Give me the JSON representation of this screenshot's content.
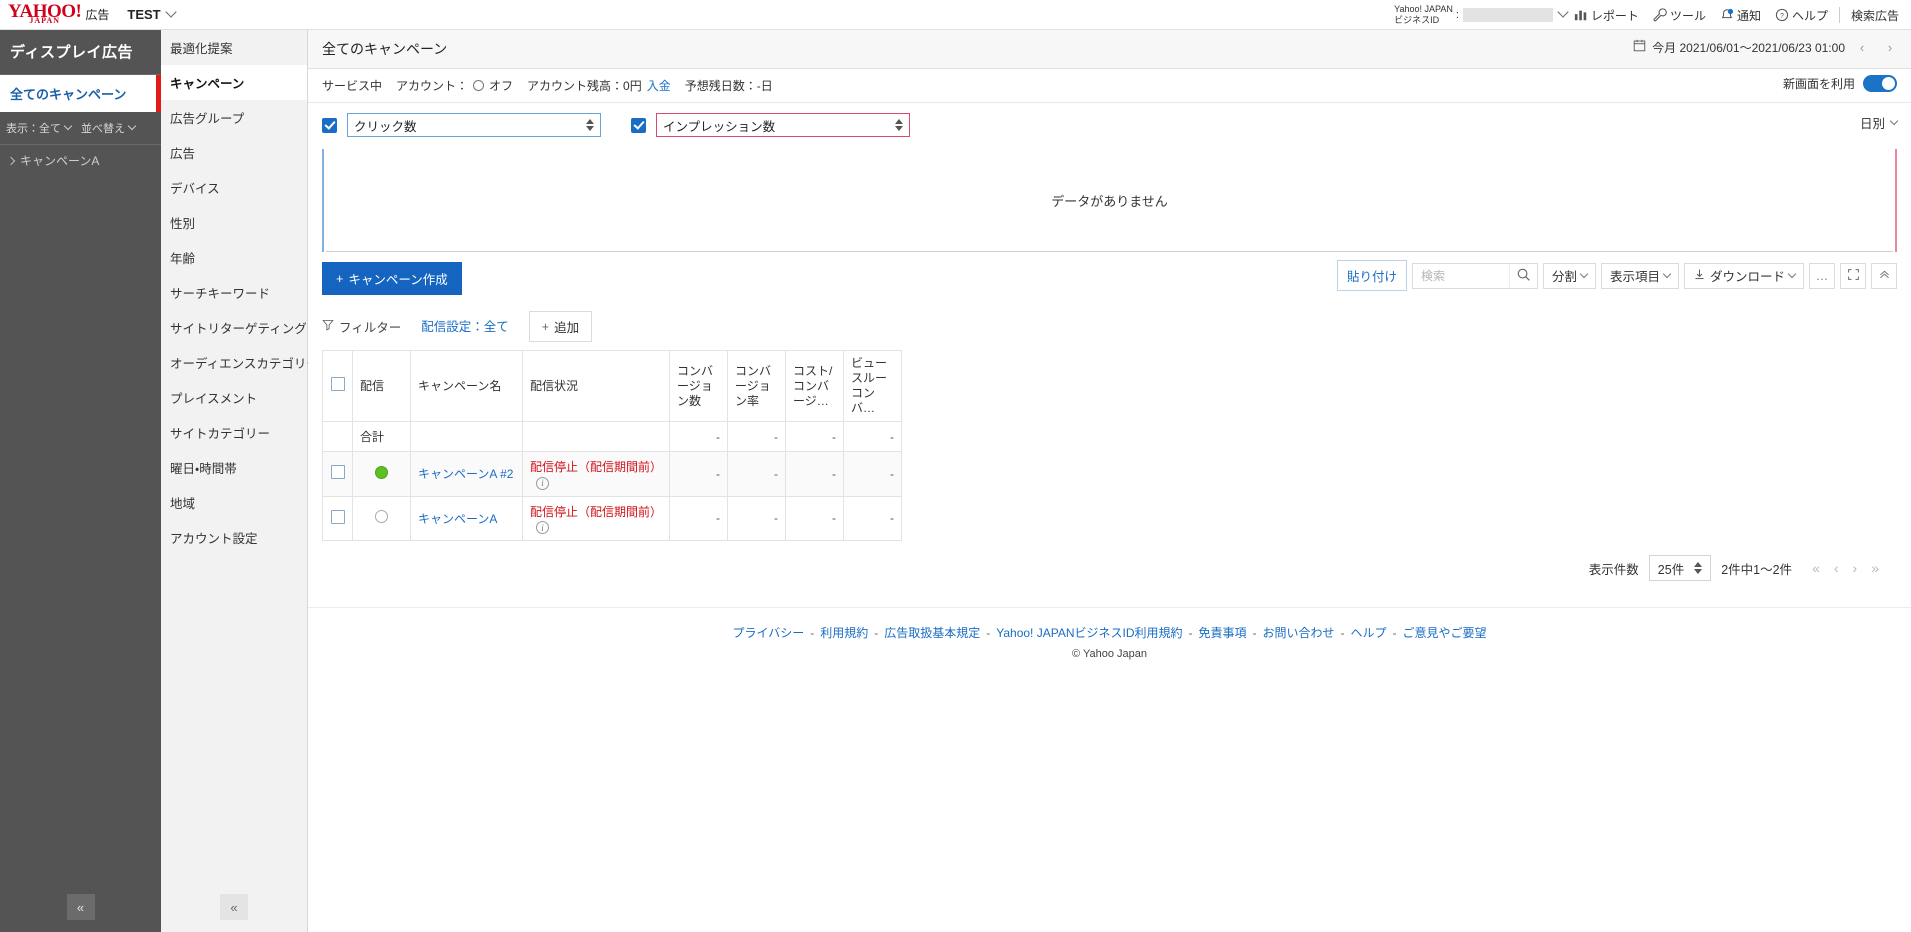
{
  "topbar": {
    "logo_text": "YAHOO!",
    "logo_sub": "JAPAN",
    "logo_suffix": "広告",
    "account_name": "TEST",
    "bizid_line1": "Yahoo! JAPAN",
    "bizid_line2": "ビジネスID",
    "bizid_colon": ":",
    "items": [
      {
        "label": "レポート",
        "icon": "report-chart-icon"
      },
      {
        "label": "ツール",
        "icon": "wrench-icon"
      },
      {
        "label": "通知",
        "icon": "bell-icon"
      },
      {
        "label": "ヘルプ",
        "icon": "question-circle-icon"
      }
    ],
    "search_ads": "検索広告"
  },
  "sidebar": {
    "title": "ディスプレイ広告",
    "all_campaigns": "全てのキャンペーン",
    "filters": [
      {
        "label": "表示：全て"
      },
      {
        "label": "並べ替え"
      }
    ],
    "tree": [
      {
        "label": "キャンペーンA"
      }
    ],
    "collapse_icon": "chevron-double-left-icon"
  },
  "navcol": {
    "items": [
      {
        "label": "最適化提案",
        "selected": false
      },
      {
        "label": "キャンペーン",
        "selected": true
      },
      {
        "label": "広告グループ",
        "selected": false
      },
      {
        "label": "広告",
        "selected": false
      },
      {
        "label": "デバイス",
        "selected": false
      },
      {
        "label": "性別",
        "selected": false
      },
      {
        "label": "年齢",
        "selected": false
      },
      {
        "label": "サーチキーワード",
        "selected": false
      },
      {
        "label": "サイトリターゲティング",
        "selected": false
      },
      {
        "label": "オーディエンスカテゴリー",
        "selected": false
      },
      {
        "label": "プレイスメント",
        "selected": false
      },
      {
        "label": "サイトカテゴリー",
        "selected": false
      },
      {
        "label": "曜日・時間帯",
        "selected": false
      },
      {
        "label": "地域",
        "selected": false
      },
      {
        "label": "アカウント設定",
        "selected": false
      }
    ],
    "collapse_icon": "chevron-double-left-icon"
  },
  "main_header": {
    "title": "全てのキャンペーン",
    "date_range": "今月 2021/06/01〜2021/06/23 01:00",
    "calendar_icon": "calendar-icon",
    "prev_icon": "chevron-left-icon",
    "next_icon": "chevron-right-icon"
  },
  "status_bar": {
    "service_status": "サービス中",
    "account_label": "アカウント：",
    "account_state": "オフ",
    "balance_label": "アカウント残高：0円",
    "deposit_link": "入金",
    "days_label": "予想残日数：-日",
    "new_ui_label": "新画面を利用",
    "new_ui_on": true,
    "toggle_color": "#1a73c7"
  },
  "chart": {
    "metric1": "クリック数",
    "metric2": "インプレッション数",
    "metric1_checked": true,
    "metric2_checked": true,
    "granularity": "日別",
    "empty_message": "データがありません",
    "metric1_border": "#6ba3d6",
    "metric2_border": "#d94b6a"
  },
  "toolbar": {
    "create_campaign": "キャンペーン作成",
    "plus_icon": "plus-icon",
    "paste": "貼り付け",
    "search_placeholder": "検索",
    "search_value": "",
    "search_icon": "search-icon",
    "split": "分割",
    "columns": "表示項目",
    "download": "ダウンロード",
    "download_icon": "download-icon",
    "more_icon": "ellipsis-icon",
    "fullscreen_icon": "expand-icon",
    "collapse_icon": "chevron-double-up-icon"
  },
  "filter_row": {
    "filter": "フィルター",
    "filter_icon": "funnel-icon",
    "delivery_chip": "配信設定：全て",
    "add": "追加",
    "add_icon": "plus-icon"
  },
  "table": {
    "headers": [
      {
        "label": "",
        "type": "checkbox"
      },
      {
        "label": "配信"
      },
      {
        "label": "キャンペーン名"
      },
      {
        "label": "配信状況"
      },
      {
        "label": "コンバージョン数"
      },
      {
        "label": "コンバージョン率"
      },
      {
        "label": "コスト/コンバージ…"
      },
      {
        "label": "ビュースルーコンバ…"
      }
    ],
    "total_row": {
      "label": "合計",
      "values": [
        "-",
        "-",
        "-",
        "-"
      ]
    },
    "rows": [
      {
        "delivery_state": "on",
        "name": "キャンペーンA #2",
        "status": "配信停止（配信期間前）",
        "info_icon": "info-icon",
        "values": [
          "-",
          "-",
          "-",
          "-"
        ]
      },
      {
        "delivery_state": "off",
        "name": "キャンペーンA",
        "status": "配信停止（配信期間前）",
        "info_icon": "info-icon",
        "values": [
          "-",
          "-",
          "-",
          "-"
        ]
      }
    ]
  },
  "pagination": {
    "rows_label": "表示件数",
    "rows_value": "25件",
    "range_text": "2件中1〜2件",
    "first_icon": "chevron-double-left-icon",
    "prev_icon": "chevron-left-icon",
    "next_icon": "chevron-right-icon",
    "last_icon": "chevron-double-right-icon"
  },
  "footer": {
    "links": [
      "プライバシー",
      "利用規約",
      "広告取扱基本規定",
      "Yahoo! JAPANビジネスID利用規約",
      "免責事項",
      "お問い合わせ",
      "ヘルプ",
      "ご意見やご要望"
    ],
    "copyright": "© Yahoo Japan"
  }
}
